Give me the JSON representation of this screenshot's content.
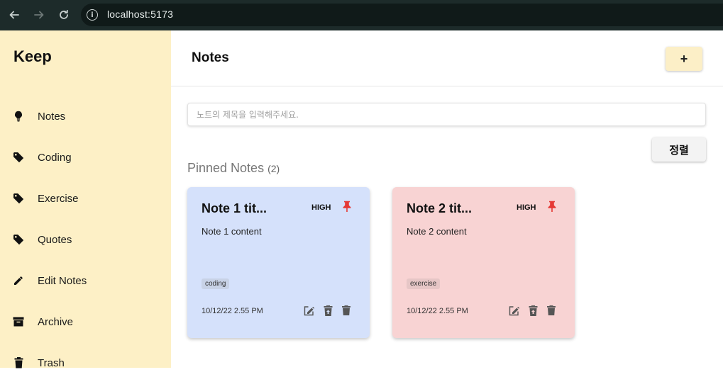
{
  "browser": {
    "url": "localhost:5173"
  },
  "sidebar": {
    "brand": "Keep",
    "items": [
      {
        "label": "Notes",
        "icon": "lightbulb-icon"
      },
      {
        "label": "Coding",
        "icon": "tag-icon"
      },
      {
        "label": "Exercise",
        "icon": "tag-icon"
      },
      {
        "label": "Quotes",
        "icon": "tag-icon"
      },
      {
        "label": "Edit Notes",
        "icon": "pencil-icon"
      },
      {
        "label": "Archive",
        "icon": "archive-icon"
      },
      {
        "label": "Trash",
        "icon": "trash-icon"
      }
    ]
  },
  "header": {
    "title": "Notes",
    "add_label": "+"
  },
  "search": {
    "placeholder": "노트의 제목을 입력해주세요."
  },
  "sort": {
    "label": "정렬"
  },
  "pinned": {
    "title": "Pinned Notes",
    "count": "(2)"
  },
  "notes": [
    {
      "title": "Note 1 tit...",
      "priority": "HIGH",
      "content": "Note 1 content",
      "tag": "coding",
      "date": "10/12/22 2.55 PM",
      "bg": "#d5e1fb",
      "tag_bg": "#c8d2e6"
    },
    {
      "title": "Note 2 tit...",
      "priority": "HIGH",
      "content": "Note 2 content",
      "tag": "exercise",
      "date": "10/12/22 2.55 PM",
      "bg": "#f8d3d3",
      "tag_bg": "#e6c6c6"
    }
  ],
  "colors": {
    "sidebar": "#fdf0c6",
    "accent_button": "#fcefc7",
    "pin": "#e53935"
  }
}
